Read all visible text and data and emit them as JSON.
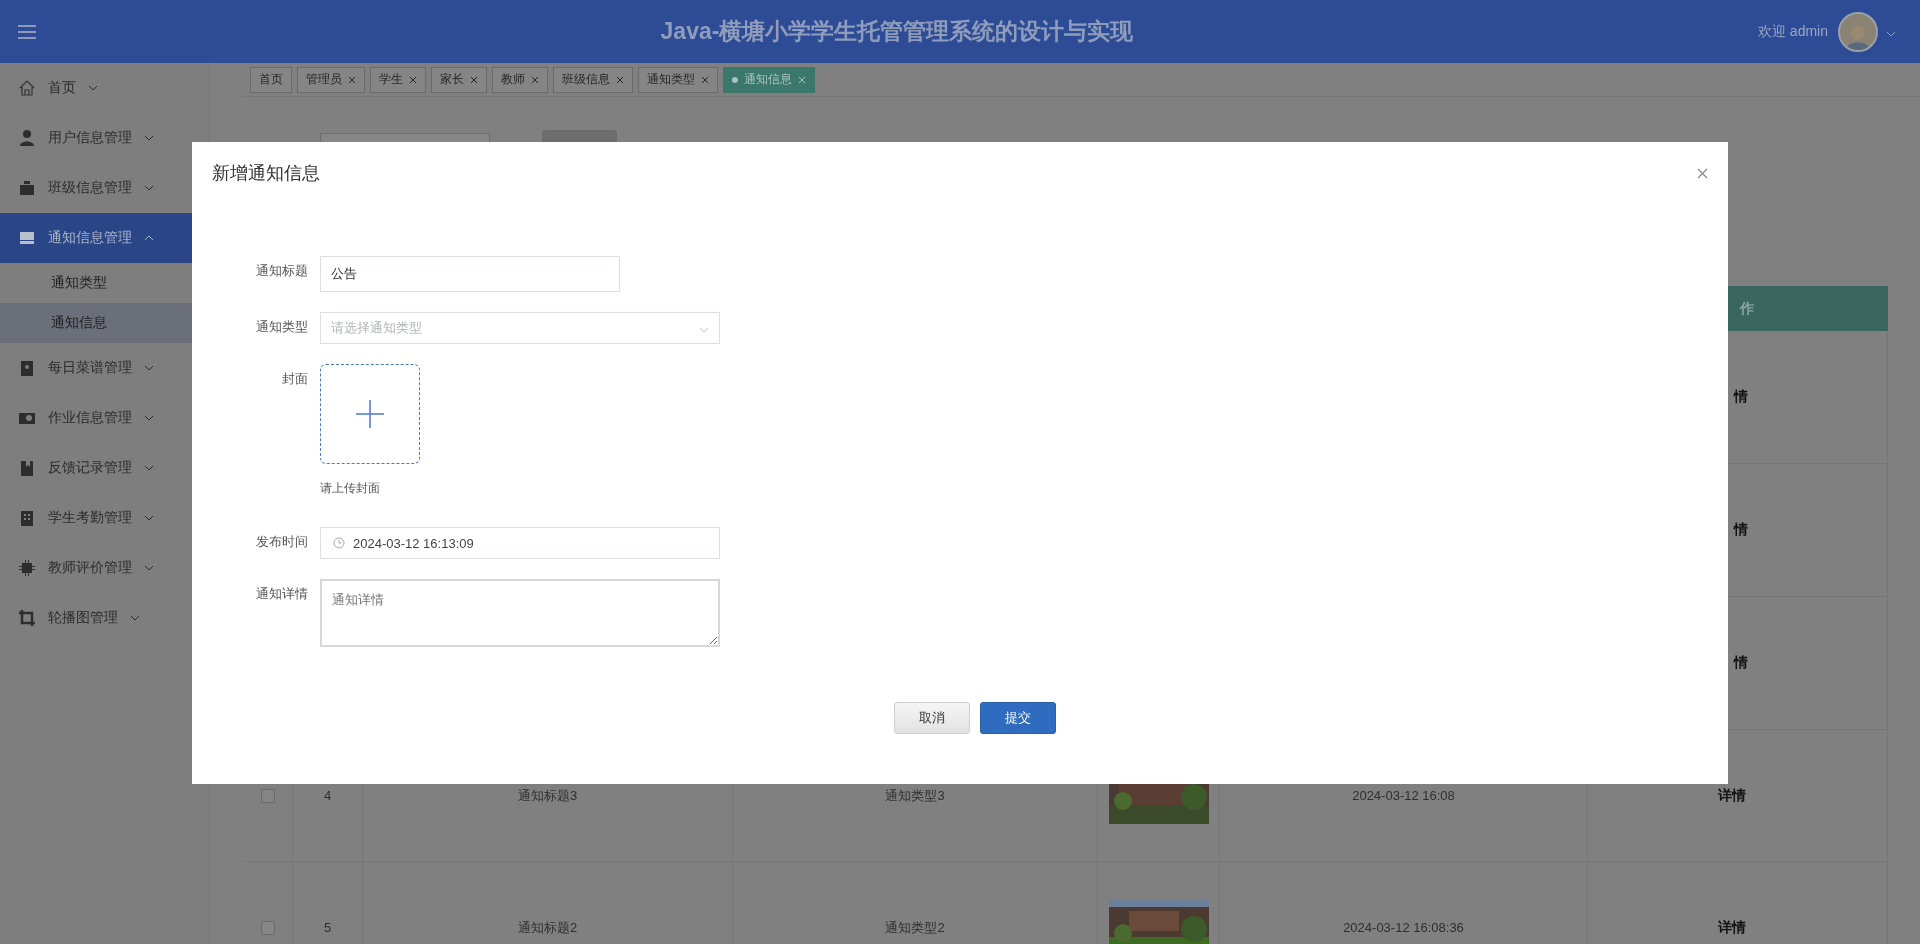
{
  "header": {
    "title": "Java-横塘小学学生托管管理系统的设计与实现",
    "welcome": "欢迎 admin"
  },
  "sidebar": {
    "items": [
      {
        "label": "首页",
        "selected": false,
        "expanded": false
      },
      {
        "label": "用户信息管理",
        "selected": false,
        "expanded": false
      },
      {
        "label": "班级信息管理",
        "selected": false,
        "expanded": false
      },
      {
        "label": "通知信息管理",
        "selected": true,
        "expanded": true,
        "children": [
          {
            "label": "通知类型",
            "selected": false
          },
          {
            "label": "通知信息",
            "selected": true
          }
        ]
      },
      {
        "label": "每日菜谱管理",
        "selected": false,
        "expanded": false
      },
      {
        "label": "作业信息管理",
        "selected": false,
        "expanded": false
      },
      {
        "label": "反馈记录管理",
        "selected": false,
        "expanded": false
      },
      {
        "label": "学生考勤管理",
        "selected": false,
        "expanded": false
      },
      {
        "label": "教师评价管理",
        "selected": false,
        "expanded": false
      },
      {
        "label": "轮播图管理",
        "selected": false,
        "expanded": false
      }
    ]
  },
  "tabs": [
    {
      "label": "首页",
      "selected": false,
      "closable": false
    },
    {
      "label": "管理员",
      "selected": false,
      "closable": true
    },
    {
      "label": "学生",
      "selected": false,
      "closable": true
    },
    {
      "label": "家长",
      "selected": false,
      "closable": true
    },
    {
      "label": "教师",
      "selected": false,
      "closable": true
    },
    {
      "label": "班级信息",
      "selected": false,
      "closable": true
    },
    {
      "label": "通知类型",
      "selected": false,
      "closable": true
    },
    {
      "label": "通知信息",
      "selected": true,
      "closable": true
    }
  ],
  "table": {
    "action_header": "作",
    "rows": [
      {
        "action": "情"
      },
      {
        "action": "情"
      },
      {
        "action": "情"
      },
      {
        "checked": false,
        "index": "4",
        "title": "通知标题3",
        "type": "通知类型3",
        "time": "2024-03-12 16:08",
        "action": "详情"
      },
      {
        "checked": false,
        "index": "5",
        "title": "通知标题2",
        "type": "通知类型2",
        "time": "2024-03-12 16:08:36",
        "action": "详情"
      }
    ]
  },
  "dialog": {
    "title": "新增通知信息",
    "fields": [
      {
        "kind": "text",
        "label": "通知标题",
        "value": "公告"
      },
      {
        "kind": "select",
        "label": "通知类型",
        "placeholder": "请选择通知类型"
      },
      {
        "kind": "upload",
        "label": "封面",
        "hint": "请上传封面"
      },
      {
        "kind": "date",
        "label": "发布时间",
        "value": "2024-03-12 16:13:09"
      },
      {
        "kind": "textarea",
        "label": "通知详情",
        "placeholder": "通知详情"
      }
    ],
    "buttons": [
      {
        "label": "取消",
        "kind": "default"
      },
      {
        "label": "提交",
        "kind": "primary"
      }
    ]
  }
}
